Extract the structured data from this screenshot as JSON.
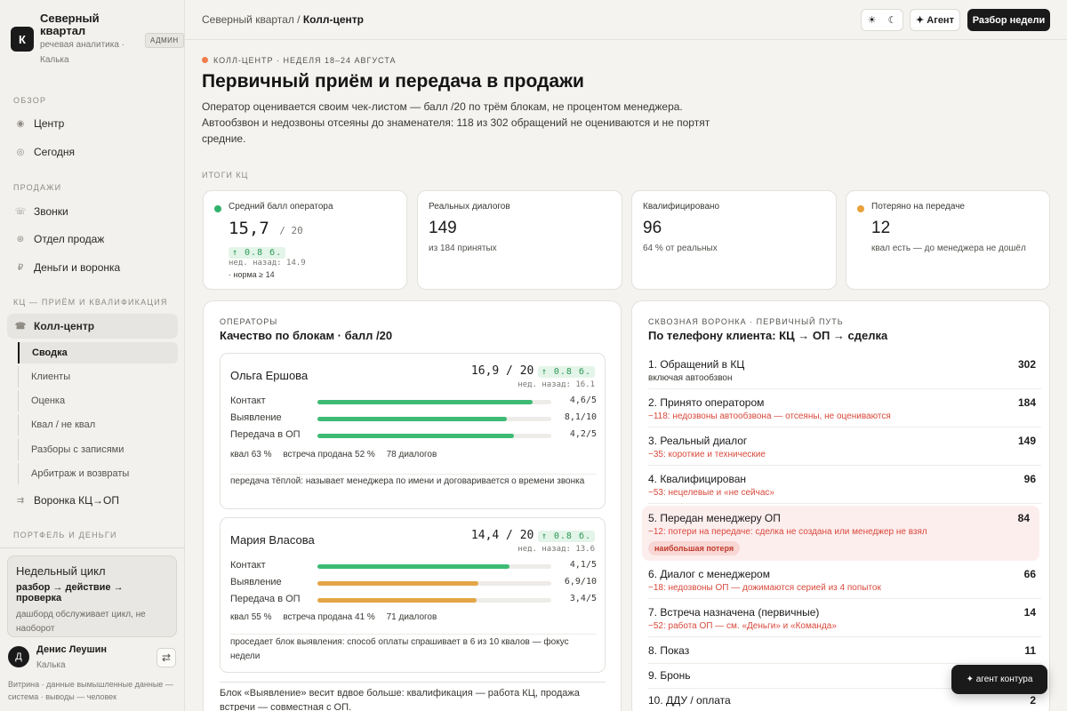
{
  "brand": {
    "logo": "К",
    "title": "Северный квартал",
    "subtitle": "речевая аналитика · Калька",
    "badge": "АДМИН"
  },
  "sidebar": {
    "sections": [
      "ОБЗОР",
      "ПРОДАЖИ",
      "КЦ — ПРИЁМ И КВАЛИФИКАЦИЯ",
      "ПОРТФЕЛЬ И ДЕНЬГИ"
    ],
    "items": [
      {
        "label": "Центр",
        "icon": "◉"
      },
      {
        "label": "Сегодня",
        "icon": "◎"
      },
      {
        "label": "Звонки",
        "icon": "☏"
      },
      {
        "label": "Отдел продаж",
        "icon": "⊛"
      },
      {
        "label": "Деньги и воронка",
        "icon": "₽"
      },
      {
        "label": "Колл-центр",
        "icon": "☎"
      },
      {
        "label": "Воронка КЦ→ОП",
        "icon": "⇉"
      }
    ],
    "sub_items": [
      "Сводка",
      "Клиенты",
      "Оценка",
      "Квал / не квал",
      "Разборы с записями",
      "Арбитраж и возвраты"
    ],
    "cycle": {
      "title": "Недельный цикл",
      "flow": "разбор → действие → проверка",
      "note": "дашборд обслуживает цикл, не наоборот"
    },
    "user": {
      "initial": "Д",
      "name": "Денис Леушин",
      "org": "Калька",
      "swap": "⇄"
    },
    "footer": "Витрина · данные вымышленные данные — система · выводы — человек"
  },
  "topbar": {
    "crumb_parent": "Северный квартал /",
    "crumb_current": "Колл-центр",
    "sun": "☀",
    "moon": "☾",
    "agent": "✦ Агент",
    "review": "Разбор недели"
  },
  "header": {
    "eyebrow": "КОЛЛ-ЦЕНТР · НЕДЕЛЯ 18–24 АВГУСТА",
    "title": "Первичный приём и передача в продажи",
    "description": "Оператор оценивается своим чек-листом — балл /20 по трём блокам, не процентом менеджера. Автообзвон и недозвоны отсеяны до знаменателя: 118 из 302 обращений не оцениваются и не портят средние."
  },
  "kpi_section": "ИТОГИ КЦ",
  "kpis": [
    {
      "label": "Средний балл оператора",
      "value": "15,7",
      "suffix": "/ 20",
      "delta": "↑ 0.8 б.",
      "prev": "нед. назад: 14.9",
      "note": "· норма ≥ 14",
      "dot": "#2fb36b"
    },
    {
      "label": "Реальных диалогов",
      "value": "149",
      "sub": "из 184 принятых"
    },
    {
      "label": "Квалифицировано",
      "value": "96",
      "sub": "64 % от реальных"
    },
    {
      "label": "Потеряно на передаче",
      "value": "12",
      "sub": "квал есть — до менеджера не дошёл",
      "dot": "#e9a23b"
    }
  ],
  "operators_panel": {
    "eyebrow": "ОПЕРАТОРЫ",
    "title": "Качество по блокам · балл /20",
    "operators": [
      {
        "name": "Ольга Ершова",
        "score": "16,9 / 20",
        "delta": "↑ 0.8 б.",
        "prev": "нед. назад: 16.1",
        "metrics": [
          {
            "label": "Контакт",
            "value": "4,6/5",
            "fraction": 0.92,
            "color": "#3dbb74"
          },
          {
            "label": "Выявление",
            "value": "8,1/10",
            "fraction": 0.81,
            "color": "#3dbb74"
          },
          {
            "label": "Передача в ОП",
            "value": "4,2/5",
            "fraction": 0.84,
            "color": "#3dbb74"
          }
        ],
        "stats": [
          "квал 63 %",
          "встреча продана 52 %",
          "78 диалогов"
        ],
        "note": "передача тёплой: называет менеджера по имени и договаривается о времени звонка"
      },
      {
        "name": "Мария Власова",
        "score": "14,4 / 20",
        "delta": "↑ 0.8 б.",
        "prev": "нед. назад: 13.6",
        "metrics": [
          {
            "label": "Контакт",
            "value": "4,1/5",
            "fraction": 0.82,
            "color": "#3dbb74"
          },
          {
            "label": "Выявление",
            "value": "6,9/10",
            "fraction": 0.69,
            "color": "#e3a546"
          },
          {
            "label": "Передача в ОП",
            "value": "3,4/5",
            "fraction": 0.68,
            "color": "#e3a546"
          }
        ],
        "stats": [
          "квал 55 %",
          "встреча продана 41 %",
          "71 диалогов"
        ],
        "note": "проседает блок выявления: способ оплаты спрашивает в 6 из 10 квалов — фокус недели"
      }
    ],
    "footer": "Блок «Выявление» весит вдвое больше: квалификация — работа КЦ, продажа встречи — совместная с ОП."
  },
  "funnel_panel": {
    "eyebrow": "СКВОЗНАЯ ВОРОНКА · ПЕРВИЧНЫЙ ПУТЬ",
    "title": "По телефону клиента: КЦ → ОП → сделка",
    "highlight_tag": "наибольшая потеря",
    "rows": [
      {
        "label": "1. Обращений в КЦ",
        "value": "302",
        "sub": "включая автообзвон",
        "sub_color": "#3a3834"
      },
      {
        "label": "2. Принято оператором",
        "value": "184",
        "sub": "−118: недозвоны автообзвона — отсеяны, не оцениваются",
        "sub_color": "#d9483b"
      },
      {
        "label": "3. Реальный диалог",
        "value": "149",
        "sub": "−35: короткие и технические",
        "sub_color": "#d9483b"
      },
      {
        "label": "4. Квалифицирован",
        "value": "96",
        "sub": "−53: нецелевые и «не сейчас»",
        "sub_color": "#d9483b"
      },
      {
        "label": "5. Передан менеджеру ОП",
        "value": "84",
        "sub": "−12: потери на передаче: сделка не создана или менеджер не взял",
        "sub_color": "#d9483b"
      },
      {
        "label": "6. Диалог с менеджером",
        "value": "66",
        "sub": "−18: недозвоны ОП — дожимаются серией из 4 попыток",
        "sub_color": "#d9483b"
      },
      {
        "label": "7. Встреча назначена (первичные)",
        "value": "14",
        "sub": "−52: работа ОП — см. «Деньги» и «Команда»",
        "sub_color": "#d9483b"
      },
      {
        "label": "8. Показ",
        "value": "11",
        "sub": "",
        "sub_color": "#d9483b"
      },
      {
        "label": "9. Бронь",
        "value": "",
        "sub": "",
        "sub_color": "#d9483b"
      },
      {
        "label": "10. ДДУ / оплата",
        "value": "2",
        "sub": "",
        "sub_color": "#d9483b"
      }
    ]
  },
  "agent_pill": "✦ агент контура"
}
